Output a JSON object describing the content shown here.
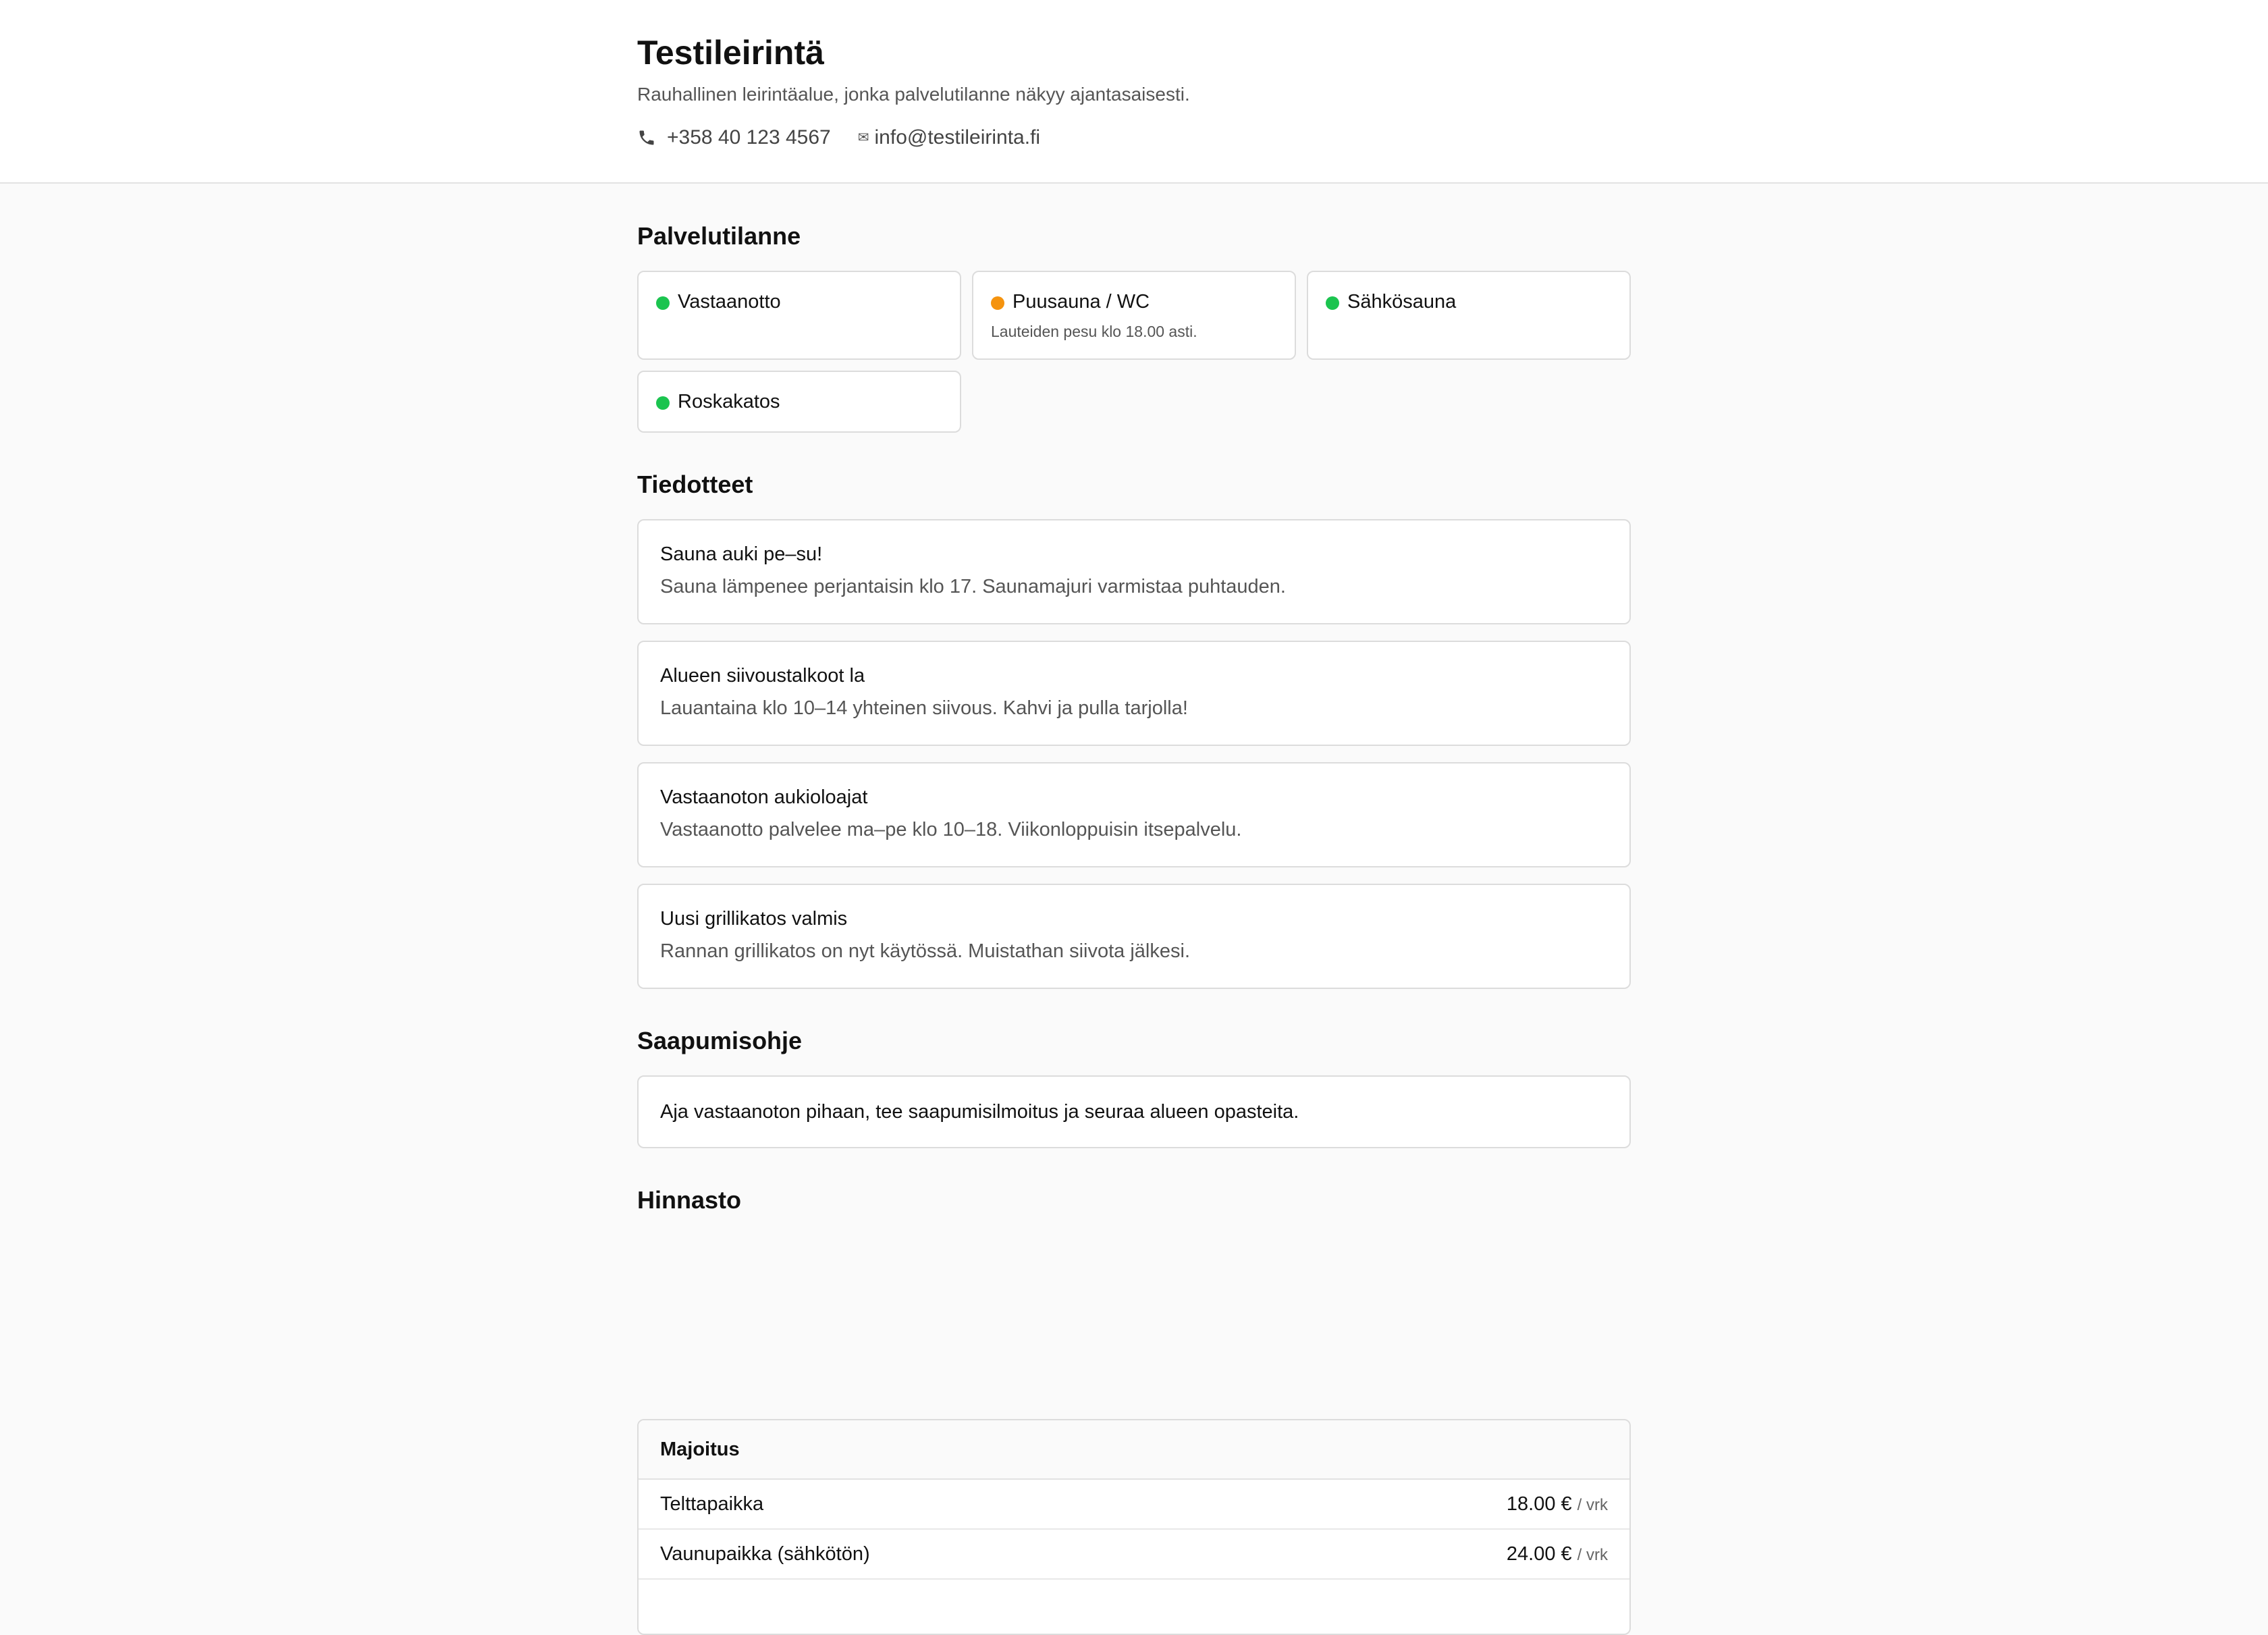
{
  "site": {
    "title": "Testileirintä",
    "subtitle": "Rauhallinen leirintäalue, jonka palvelutilanne näkyy ajantasaisesti.",
    "phone": "+358 40 123 4567",
    "email": "info@testileirinta.fi"
  },
  "status": {
    "heading": "Palvelutilanne",
    "items": [
      {
        "name": "Vastaanotto",
        "note": "",
        "color": "#1bc44f"
      },
      {
        "name": "Puusauna / WC",
        "note": "Lauteiden pesu klo 18.00 asti.",
        "color": "#f5930e"
      },
      {
        "name": "Sähkösauna",
        "note": "",
        "color": "#1bc44f"
      },
      {
        "name": "Roskakatos",
        "note": "",
        "color": "#1bc44f"
      }
    ]
  },
  "notices": {
    "heading": "Tiedotteet",
    "items": [
      {
        "title": "Sauna auki pe–su!",
        "text": "Sauna lämpenee perjantaisin klo 17. Saunamajuri varmistaa puhtauden."
      },
      {
        "title": "Alueen siivoustalkoot la",
        "text": "Lauantaina klo 10–14 yhteinen siivous. Kahvi ja pulla tarjolla!"
      },
      {
        "title": "Vastaanoton aukioloajat",
        "text": "Vastaanotto palvelee ma–pe klo 10–18. Viikonloppuisin itsepalvelu."
      },
      {
        "title": "Uusi grillikatos valmis",
        "text": "Rannan grillikatos on nyt käytössä. Muistathan siivota jälkesi."
      }
    ]
  },
  "arrival": {
    "heading": "Saapumisohje",
    "text": "Aja vastaanoton pihaan, tee saapumisilmoitus ja seuraa alueen opasteita."
  },
  "pricing": {
    "heading": "Hinnasto",
    "category": "Majoitus",
    "rows": [
      {
        "name": "Telttapaikka",
        "price": "18.00 €",
        "unit": "/ vrk"
      },
      {
        "name": "Vaunupaikka (sähkötön)",
        "price": "24.00 €",
        "unit": "/ vrk"
      }
    ]
  },
  "icons": {
    "phone": "phone-icon",
    "email": "mail-icon"
  },
  "colors": {
    "status_ok": "#1bc44f",
    "status_warning": "#f5930e"
  }
}
